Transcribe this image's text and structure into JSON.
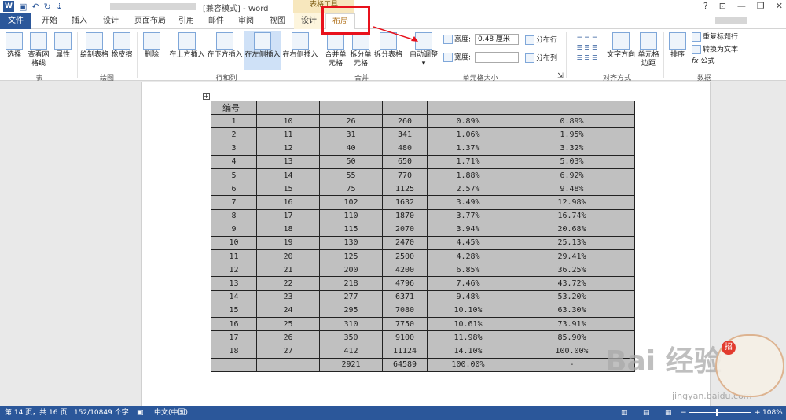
{
  "window": {
    "title": "[兼容模式] - Word",
    "context_header": "表格工具",
    "controls": [
      "?",
      "⊡",
      "—",
      "❐",
      "✕"
    ]
  },
  "tabs": [
    {
      "label": "文件"
    },
    {
      "label": "开始"
    },
    {
      "label": "插入"
    },
    {
      "label": "设计"
    },
    {
      "label": "页面布局"
    },
    {
      "label": "引用"
    },
    {
      "label": "邮件"
    },
    {
      "label": "审阅"
    },
    {
      "label": "视图"
    },
    {
      "label": "设计"
    },
    {
      "label": "布局"
    }
  ],
  "ribbon": {
    "table": {
      "select": "选择",
      "gridlines": "查看网格线",
      "properties": "属性",
      "label": "表"
    },
    "draw": {
      "draw_table": "绘制表格",
      "eraser": "橡皮擦",
      "label": "绘图"
    },
    "rows_cols": {
      "delete": "删除",
      "insert_above": "在上方插入",
      "insert_below": "在下方插入",
      "insert_left": "在左侧插入",
      "insert_right": "在右侧插入",
      "label": "行和列"
    },
    "merge": {
      "merge_cells": "合并单元格",
      "split_cells": "拆分单元格",
      "split_table": "拆分表格",
      "label": "合并"
    },
    "cell_size": {
      "autofit": "自动调整",
      "height_label": "高度:",
      "height_value": "0.48 厘米",
      "width_label": "宽度:",
      "width_value": "",
      "dist_rows": "分布行",
      "dist_cols": "分布列",
      "label": "单元格大小"
    },
    "alignment": {
      "text_direction": "文字方向",
      "cell_margins": "单元格边距",
      "label": "对齐方式"
    },
    "data": {
      "sort": "排序",
      "repeat_header": "重复标题行",
      "convert": "转换为文本",
      "formula": "公式",
      "label": "数据"
    }
  },
  "table": {
    "header": [
      "编号",
      "",
      "",
      "",
      "",
      ""
    ],
    "rows": [
      [
        "1",
        "10",
        "26",
        "260",
        "0.89%",
        "0.89%"
      ],
      [
        "2",
        "11",
        "31",
        "341",
        "1.06%",
        "1.95%"
      ],
      [
        "3",
        "12",
        "40",
        "480",
        "1.37%",
        "3.32%"
      ],
      [
        "4",
        "13",
        "50",
        "650",
        "1.71%",
        "5.03%"
      ],
      [
        "5",
        "14",
        "55",
        "770",
        "1.88%",
        "6.92%"
      ],
      [
        "6",
        "15",
        "75",
        "1125",
        "2.57%",
        "9.48%"
      ],
      [
        "7",
        "16",
        "102",
        "1632",
        "3.49%",
        "12.98%"
      ],
      [
        "8",
        "17",
        "110",
        "1870",
        "3.77%",
        "16.74%"
      ],
      [
        "9",
        "18",
        "115",
        "2070",
        "3.94%",
        "20.68%"
      ],
      [
        "10",
        "19",
        "130",
        "2470",
        "4.45%",
        "25.13%"
      ],
      [
        "11",
        "20",
        "125",
        "2500",
        "4.28%",
        "29.41%"
      ],
      [
        "12",
        "21",
        "200",
        "4200",
        "6.85%",
        "36.25%"
      ],
      [
        "13",
        "22",
        "218",
        "4796",
        "7.46%",
        "43.72%"
      ],
      [
        "14",
        "23",
        "277",
        "6371",
        "9.48%",
        "53.20%"
      ],
      [
        "15",
        "24",
        "295",
        "7080",
        "10.10%",
        "63.30%"
      ],
      [
        "16",
        "25",
        "310",
        "7750",
        "10.61%",
        "73.91%"
      ],
      [
        "17",
        "26",
        "350",
        "9100",
        "11.98%",
        "85.90%"
      ],
      [
        "18",
        "27",
        "412",
        "11124",
        "14.10%",
        "100.00%"
      ],
      [
        "",
        "",
        "2921",
        "64589",
        "100.00%",
        "-"
      ]
    ]
  },
  "watermark": {
    "text": "Bai 经验",
    "url": "jingyan.baidu.com",
    "badge": "招"
  },
  "status": {
    "page": "第 14 页，共 16 页",
    "words": "152/10849 个字",
    "language": "中文(中国)",
    "zoom": "108%",
    "zoom_minus": "−",
    "zoom_plus": "+"
  },
  "colors": {
    "accent": "#2b579a",
    "context_tab": "#fdf5dd",
    "highlight_box": "#e8111c",
    "table_fill": "#c0c0c0"
  }
}
